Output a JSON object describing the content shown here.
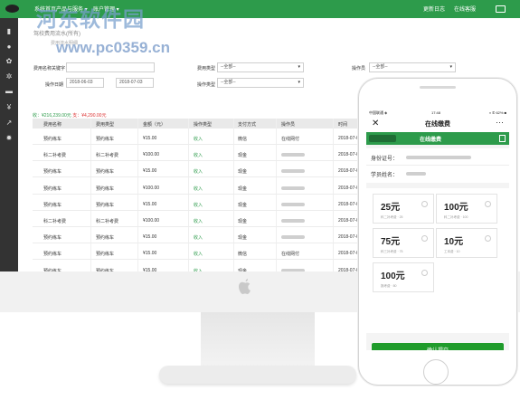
{
  "watermark": {
    "brand": "河东软件园",
    "url": "www.pc0359.cn"
  },
  "desktop": {
    "nav": {
      "home": "系统首页",
      "products": "产品与服务 ▾",
      "accounts": "账户管理 ▾",
      "update_log": "更新日志",
      "help": "在线客服"
    },
    "page_title": "驾校费用流水(所有)",
    "page_subtitle": "费用流水明细",
    "filters": {
      "name_label": "费用名称关键字：",
      "date_label": "操作日期",
      "date_from": "2018-06-03",
      "date_to": "2018-07-03",
      "fee_type_label": "费用类型",
      "fee_type_value": "--全部--",
      "op_type_label": "操作类型",
      "op_type_value": "--全部--",
      "operator_label": "操作员",
      "operator_value": "--全部--"
    },
    "summary": {
      "income": "收：¥216,239.00元",
      "expense": "支：¥4,290.00元"
    },
    "table": {
      "headers": [
        "费用名称",
        "费用类型",
        "金额（元）",
        "操作类型",
        "支付方式",
        "操作员",
        "时间"
      ],
      "rows": [
        [
          "预约练车",
          "预约练车",
          "¥15.00",
          "收入",
          "微信",
          "在线网付",
          "2018-07-0"
        ],
        [
          "科二补考费",
          "科二补考费",
          "¥100.00",
          "收入",
          "现金",
          "",
          "2018-07-0"
        ],
        [
          "预约练车",
          "预约练车",
          "¥15.00",
          "收入",
          "现金",
          "",
          "2018-07-0"
        ],
        [
          "预约练车",
          "预约练车",
          "¥100.00",
          "收入",
          "现金",
          "",
          "2018-07-0"
        ],
        [
          "预约练车",
          "预约练车",
          "¥15.00",
          "收入",
          "现金",
          "",
          "2018-07-0"
        ],
        [
          "科二补考费",
          "科二补考费",
          "¥100.00",
          "收入",
          "现金",
          "",
          "2018-07-0"
        ],
        [
          "预约练车",
          "预约练车",
          "¥15.00",
          "收入",
          "现金",
          "",
          "2018-07-0"
        ],
        [
          "预约练车",
          "预约练车",
          "¥15.00",
          "收入",
          "微信",
          "在线网付",
          "2018-07-0"
        ],
        [
          "预约练车",
          "预约练车",
          "¥15.00",
          "收入",
          "现金",
          "",
          "2018-07-0"
        ]
      ]
    }
  },
  "phone": {
    "status": {
      "carrier": "中国联通 ◈",
      "time": "17:48",
      "battery": "◑ ✆ 62% ■"
    },
    "title": "在线缴费",
    "banner_text": "在线缴费",
    "id_label": "身份证号：",
    "name_label": "学员姓名：",
    "options": [
      {
        "price": "25元",
        "desc": "科二补考费 · 25"
      },
      {
        "price": "100元",
        "desc": "科二补考费 · 100"
      },
      {
        "price": "75元",
        "desc": "科三补考费 · 75"
      },
      {
        "price": "10元",
        "desc": "工本费 · 10"
      },
      {
        "price": "100元",
        "desc": "报考费 · 80"
      }
    ],
    "confirm": "确认提交"
  },
  "colors": {
    "accent": "#2d9b4b",
    "expense": "#dd3333",
    "sidebar": "#333333"
  }
}
